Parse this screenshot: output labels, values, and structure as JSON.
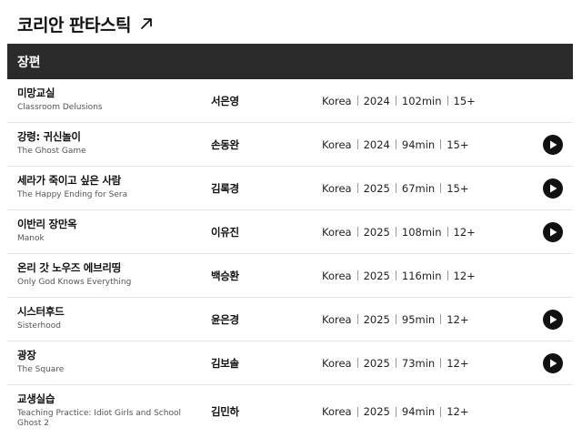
{
  "header": {
    "title": "코리안 판타스틱",
    "link_icon": "arrow-up-right-icon"
  },
  "section": {
    "title": "장편"
  },
  "films": [
    {
      "ko": "미망교실",
      "en": "Classroom Delusions",
      "director": "서은영",
      "country": "Korea",
      "year": "2024",
      "runtime": "102min",
      "rating": "15+",
      "has_play": false
    },
    {
      "ko": "강령: 귀신놀이",
      "en": "The Ghost Game",
      "director": "손동완",
      "country": "Korea",
      "year": "2024",
      "runtime": "94min",
      "rating": "15+",
      "has_play": true
    },
    {
      "ko": "세라가 죽이고 싶은 사람",
      "en": "The Happy Ending for Sera",
      "director": "김록경",
      "country": "Korea",
      "year": "2025",
      "runtime": "67min",
      "rating": "15+",
      "has_play": true
    },
    {
      "ko": "이반리 장만옥",
      "en": "Manok",
      "director": "이유진",
      "country": "Korea",
      "year": "2025",
      "runtime": "108min",
      "rating": "12+",
      "has_play": true
    },
    {
      "ko": "온리 갓 노우즈 에브리띵",
      "en": "Only God Knows Everything",
      "director": "백승환",
      "country": "Korea",
      "year": "2025",
      "runtime": "116min",
      "rating": "12+",
      "has_play": false
    },
    {
      "ko": "시스터후드",
      "en": "Sisterhood",
      "director": "윤은경",
      "country": "Korea",
      "year": "2025",
      "runtime": "95min",
      "rating": "12+",
      "has_play": true
    },
    {
      "ko": "광장",
      "en": "The Square",
      "director": "김보솔",
      "country": "Korea",
      "year": "2025",
      "runtime": "73min",
      "rating": "12+",
      "has_play": true
    },
    {
      "ko": "교생실습",
      "en": "Teaching Practice: Idiot Girls and School Ghost 2",
      "director": "김민하",
      "country": "Korea",
      "year": "2025",
      "runtime": "94min",
      "rating": "12+",
      "has_play": false
    }
  ],
  "icons": {
    "play": "play-icon"
  },
  "colors": {
    "header_bar": "#2b2b2b",
    "play_button": "#111111",
    "divider": "#e4e4e4"
  }
}
